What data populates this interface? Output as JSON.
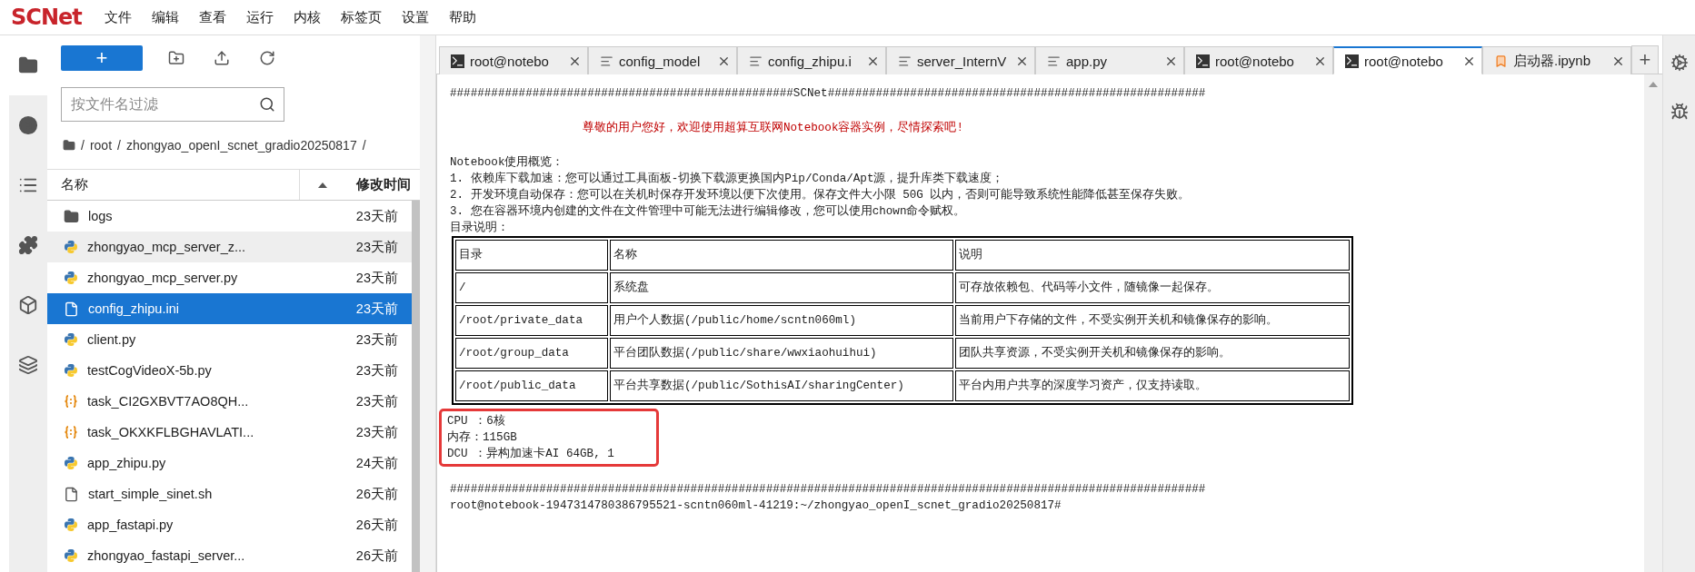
{
  "menu_bar": {
    "logo": "SCNet",
    "items": [
      "文件",
      "编辑",
      "查看",
      "运行",
      "内核",
      "标签页",
      "设置",
      "帮助"
    ]
  },
  "activity_bar": [
    {
      "selected": true
    },
    {
      "selected": false
    },
    {
      "selected": false
    },
    {
      "selected": false
    },
    {
      "selected": false
    },
    {
      "selected": false
    }
  ],
  "file_browser": {
    "new_button": "+",
    "filter_placeholder": "按文件名过滤",
    "breadcrumb": [
      "/",
      "root",
      "/",
      "zhongyao_openI_scnet_gradio20250817",
      "/"
    ],
    "columns": [
      "名称",
      "修改时间"
    ],
    "files": [
      {
        "name": "logs",
        "modified": "23天前",
        "kind": "folder",
        "selected": false,
        "hovered": false
      },
      {
        "name": "zhongyao_mcp_server_z...",
        "modified": "23天前",
        "kind": "python",
        "selected": false,
        "hovered": true
      },
      {
        "name": "zhongyao_mcp_server.py",
        "modified": "23天前",
        "kind": "python",
        "selected": false,
        "hovered": false
      },
      {
        "name": "config_zhipu.ini",
        "modified": "23天前",
        "kind": "file",
        "selected": true,
        "hovered": false
      },
      {
        "name": "client.py",
        "modified": "23天前",
        "kind": "python",
        "selected": false,
        "hovered": false
      },
      {
        "name": "testCogVideoX-5b.py",
        "modified": "23天前",
        "kind": "python",
        "selected": false,
        "hovered": false
      },
      {
        "name": "task_CI2GXBVT7AO8QH...",
        "modified": "23天前",
        "kind": "json",
        "selected": false,
        "hovered": false
      },
      {
        "name": "task_OKXKFLBGHAVLATI...",
        "modified": "23天前",
        "kind": "json",
        "selected": false,
        "hovered": false
      },
      {
        "name": "app_zhipu.py",
        "modified": "24天前",
        "kind": "python",
        "selected": false,
        "hovered": false
      },
      {
        "name": "start_simple_sinet.sh",
        "modified": "26天前",
        "kind": "file",
        "selected": false,
        "hovered": false
      },
      {
        "name": "app_fastapi.py",
        "modified": "26天前",
        "kind": "python",
        "selected": false,
        "hovered": false
      },
      {
        "name": "zhongyao_fastapi_server...",
        "modified": "26天前",
        "kind": "python",
        "selected": false,
        "hovered": false
      }
    ]
  },
  "tabs": [
    {
      "label": "root@notebo",
      "kind": "terminal",
      "selected": false
    },
    {
      "label": "config_model",
      "kind": "text",
      "selected": false
    },
    {
      "label": "config_zhipu.i",
      "kind": "text",
      "selected": false
    },
    {
      "label": "server_InternV",
      "kind": "text",
      "selected": false
    },
    {
      "label": "app.py",
      "kind": "text",
      "selected": false
    },
    {
      "label": "root@notebo",
      "kind": "terminal",
      "selected": false
    },
    {
      "label": "root@notebo",
      "kind": "terminal",
      "selected": true
    },
    {
      "label": "启动器.ipynb",
      "kind": "notebook",
      "selected": false
    }
  ],
  "new_tab_button": "+",
  "terminal": {
    "banner": "##################################################SCNet#######################################################",
    "greeting": "尊敬的用户您好，欢迎使用超算互联网Notebook容器实例，尽情探索吧!",
    "overview": [
      "Notebook使用概览：",
      "1. 依赖库下载加速：您可以通过工具面板-切换下载源更换国内Pip/Conda/Apt源，提升库类下载速度；",
      "2. 开发环境自动保存：您可以在关机时保存开发环境以便下次使用。保存文件大小限 50G 以内，否则可能导致系统性能降低甚至保存失败。",
      "3. 您在容器环境内创建的文件在文件管理中可能无法进行编辑修改，您可以使用chown命令赋权。",
      "目录说明："
    ],
    "table": {
      "columns": [
        "目录",
        "名称",
        "说明"
      ],
      "rows": [
        [
          "/",
          "系统盘",
          "可存放依赖包、代码等小文件，随镜像一起保存。"
        ],
        [
          "/root/private_data",
          "用户个人数据(/public/home/scntn060ml)",
          "当前用户下存储的文件，不受实例开关机和镜像保存的影响。"
        ],
        [
          "/root/group_data",
          "平台团队数据(/public/share/wwxiaohuihui)",
          "团队共享资源，不受实例开关机和镜像保存的影响。"
        ],
        [
          "/root/public_data",
          "平台共享数据(/public/SothisAI/sharingCenter)",
          "平台内用户共享的深度学习资产，仅支持读取。"
        ]
      ]
    },
    "resources": [
      "CPU ：6核",
      "内存：115GB",
      "DCU ：异构加速卡AI 64GB, 1"
    ],
    "footer": "##############################################################################################################",
    "prompt": "root@notebook-1947314780386795521-scntn060ml-41219:~/zhongyao_openI_scnet_gradio20250817#"
  }
}
